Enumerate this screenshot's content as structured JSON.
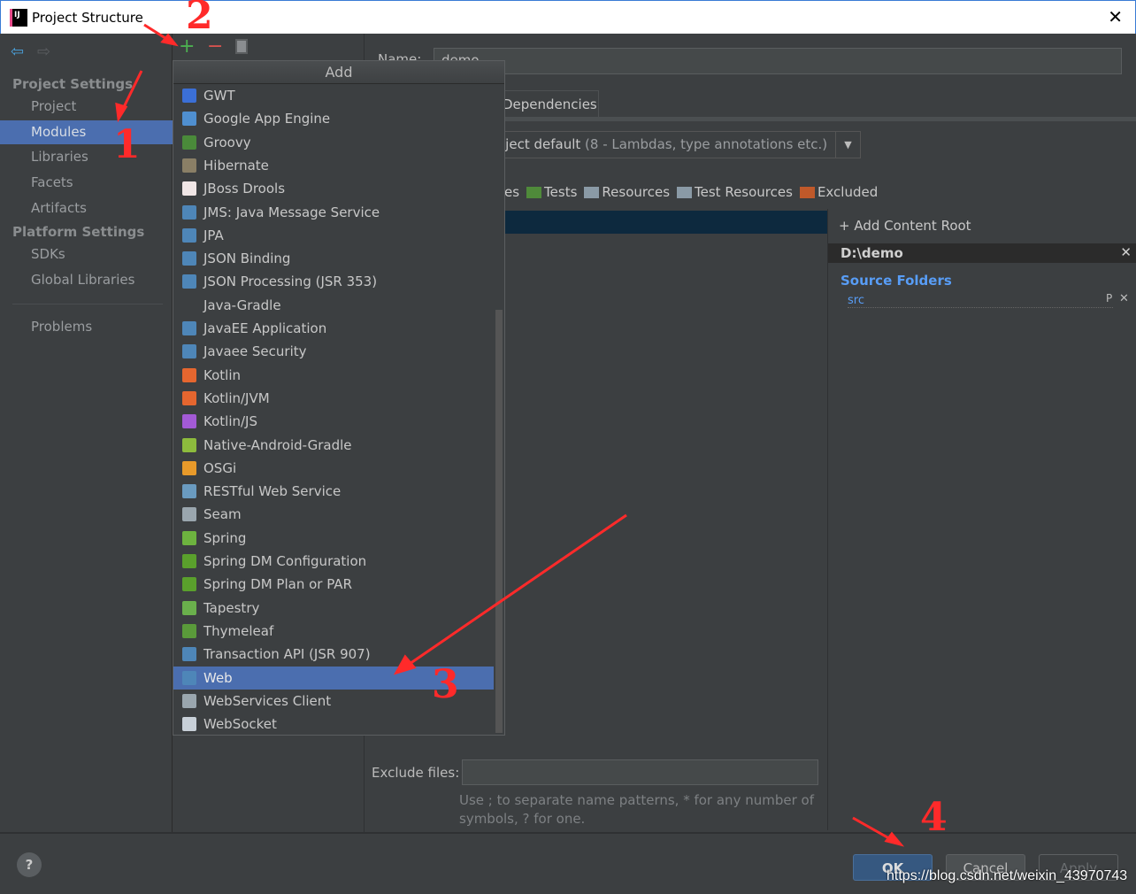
{
  "window": {
    "title": "Project Structure"
  },
  "toolbar": {
    "add": "+",
    "remove": "−"
  },
  "sidebar": {
    "section1": "Project Settings",
    "items1": [
      "Project",
      "Modules",
      "Libraries",
      "Facets",
      "Artifacts"
    ],
    "section2": "Platform Settings",
    "items2": [
      "SDKs",
      "Global Libraries"
    ],
    "problems": "Problems",
    "selected": "Modules"
  },
  "popup": {
    "title": "Add",
    "selected": "Web",
    "items": [
      {
        "label": "GWT",
        "icon": "gwt-icon",
        "color": "#3b6fd6"
      },
      {
        "label": "Google App Engine",
        "icon": "app-engine-icon",
        "color": "#4f8fd0"
      },
      {
        "label": "Groovy",
        "icon": "groovy-icon",
        "color": "#4a8a3a"
      },
      {
        "label": "Hibernate",
        "icon": "hibernate-icon",
        "color": "#8a7f66"
      },
      {
        "label": "JBoss Drools",
        "icon": "drools-icon",
        "color": "#f0e6e6"
      },
      {
        "label": "JMS: Java Message Service",
        "icon": "jms-icon",
        "color": "#4e86b8"
      },
      {
        "label": "JPA",
        "icon": "jpa-icon",
        "color": "#4e86b8"
      },
      {
        "label": "JSON Binding",
        "icon": "json-binding-icon",
        "color": "#4e86b8"
      },
      {
        "label": "JSON Processing (JSR 353)",
        "icon": "json-processing-icon",
        "color": "#4e86b8"
      },
      {
        "label": "Java-Gradle",
        "icon": "",
        "color": ""
      },
      {
        "label": "JavaEE Application",
        "icon": "javaee-icon",
        "color": "#4e86b8"
      },
      {
        "label": "Javaee Security",
        "icon": "javaee-security-icon",
        "color": "#4e86b8"
      },
      {
        "label": "Kotlin",
        "icon": "kotlin-icon",
        "color": "#e5662f"
      },
      {
        "label": "Kotlin/JVM",
        "icon": "kotlin-jvm-icon",
        "color": "#e5662f"
      },
      {
        "label": "Kotlin/JS",
        "icon": "kotlin-js-icon",
        "color": "#a35ad6"
      },
      {
        "label": "Native-Android-Gradle",
        "icon": "android-icon",
        "color": "#8dbb3d"
      },
      {
        "label": "OSGi",
        "icon": "osgi-icon",
        "color": "#e89a2a"
      },
      {
        "label": "RESTful Web Service",
        "icon": "rest-icon",
        "color": "#6a9bc0"
      },
      {
        "label": "Seam",
        "icon": "seam-icon",
        "color": "#9aa6ae"
      },
      {
        "label": "Spring",
        "icon": "spring-icon",
        "color": "#6db33f"
      },
      {
        "label": "Spring DM Configuration",
        "icon": "spring-dm-icon",
        "color": "#5aa02c"
      },
      {
        "label": "Spring DM Plan or PAR",
        "icon": "spring-dm-plan-icon",
        "color": "#5aa02c"
      },
      {
        "label": "Tapestry",
        "icon": "tapestry-icon",
        "color": "#6ab04c"
      },
      {
        "label": "Thymeleaf",
        "icon": "thymeleaf-icon",
        "color": "#5a9a3a"
      },
      {
        "label": "Transaction API (JSR 907)",
        "icon": "transaction-icon",
        "color": "#4e86b8"
      },
      {
        "label": "Web",
        "icon": "web-icon",
        "color": "#4e86b8"
      },
      {
        "label": "WebServices Client",
        "icon": "webservices-icon",
        "color": "#9aa6ae"
      },
      {
        "label": "WebSocket",
        "icon": "websocket-icon",
        "color": "#c8d0d8"
      }
    ]
  },
  "main": {
    "name_label": "Name:",
    "name_value": "demo",
    "tab": "Dependencies",
    "language_level": "oject default",
    "language_level_detail": "(8 - Lambdas, type annotations etc.)",
    "mark_as": [
      {
        "label": "es",
        "color": ""
      },
      {
        "label": "Tests",
        "color": "#4f8a3a"
      },
      {
        "label": "Resources",
        "color": "#8a9aa6"
      },
      {
        "label": "Test Resources",
        "color": "#8a9aa6"
      },
      {
        "label": "Excluded",
        "color": "#c0592a"
      }
    ],
    "add_content_root": "Add Content Root",
    "content_root": "D:\\demo",
    "source_folders": "Source Folders",
    "source_folder": "src",
    "exclude_label": "Exclude files:",
    "exclude_value": "",
    "hint1": "Use ; to separate name patterns, * for any number of",
    "hint2": "symbols, ? for one."
  },
  "buttons": {
    "ok": "OK",
    "cancel": "Cancel",
    "apply": "Apply",
    "help": "?"
  },
  "watermark": "https://blog.csdn.net/weixin_43970743",
  "annotations": [
    "1",
    "2",
    "3",
    "4"
  ],
  "colors": {
    "selection": "#4b6eaf",
    "annotation": "#ff2a2a",
    "link": "#589df6"
  }
}
